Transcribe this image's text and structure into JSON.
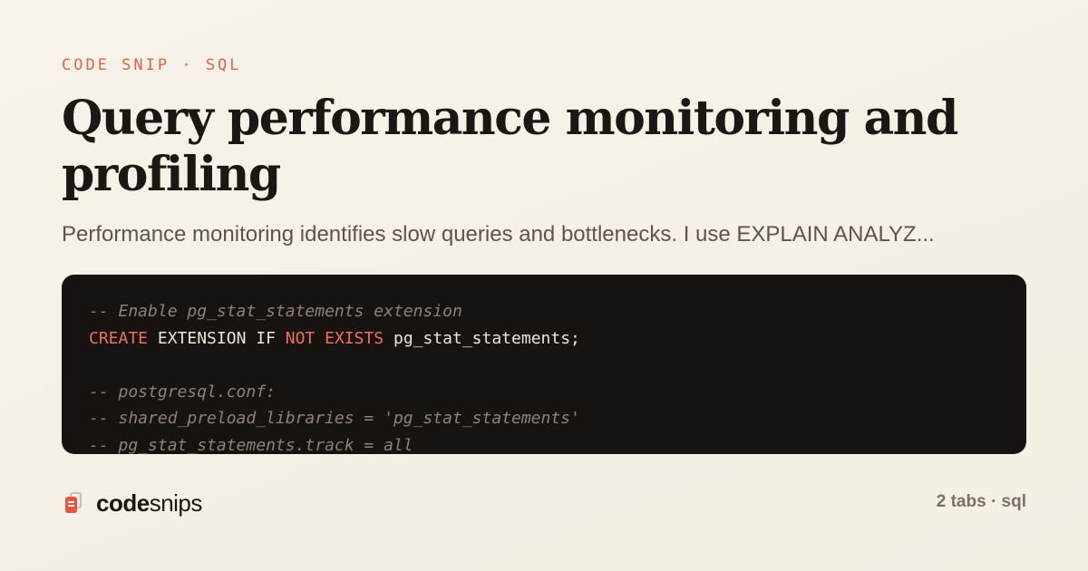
{
  "eyebrow": "CODE SNIP · SQL",
  "title": "Query performance monitoring and profiling",
  "subtitle": "Performance monitoring identifies slow queries and bottlenecks. I use EXPLAIN ANALYZ...",
  "code": {
    "lines": [
      [
        {
          "t": "comment",
          "v": "-- Enable pg_stat_statements extension"
        }
      ],
      [
        {
          "t": "keyword",
          "v": "CREATE"
        },
        {
          "t": "plain",
          "v": " EXTENSION IF "
        },
        {
          "t": "keyword",
          "v": "NOT"
        },
        {
          "t": "plain",
          "v": " "
        },
        {
          "t": "keyword",
          "v": "EXISTS"
        },
        {
          "t": "plain",
          "v": " pg_stat_statements;"
        }
      ],
      [],
      [
        {
          "t": "comment",
          "v": "-- postgresql.conf:"
        }
      ],
      [
        {
          "t": "comment",
          "v": "-- shared_preload_libraries = 'pg_stat_statements'"
        }
      ],
      [
        {
          "t": "comment",
          "v": "-- pg_stat_statements.track = all"
        }
      ]
    ]
  },
  "brand": {
    "strong": "code",
    "light": "snips",
    "icon": "snippet-logo-icon"
  },
  "meta": "2 tabs · sql",
  "colors": {
    "accent": "#e8624a",
    "background": "#f6f1e7",
    "code_background": "#161311",
    "keyword": "#f07159",
    "comment": "#8c8279"
  }
}
